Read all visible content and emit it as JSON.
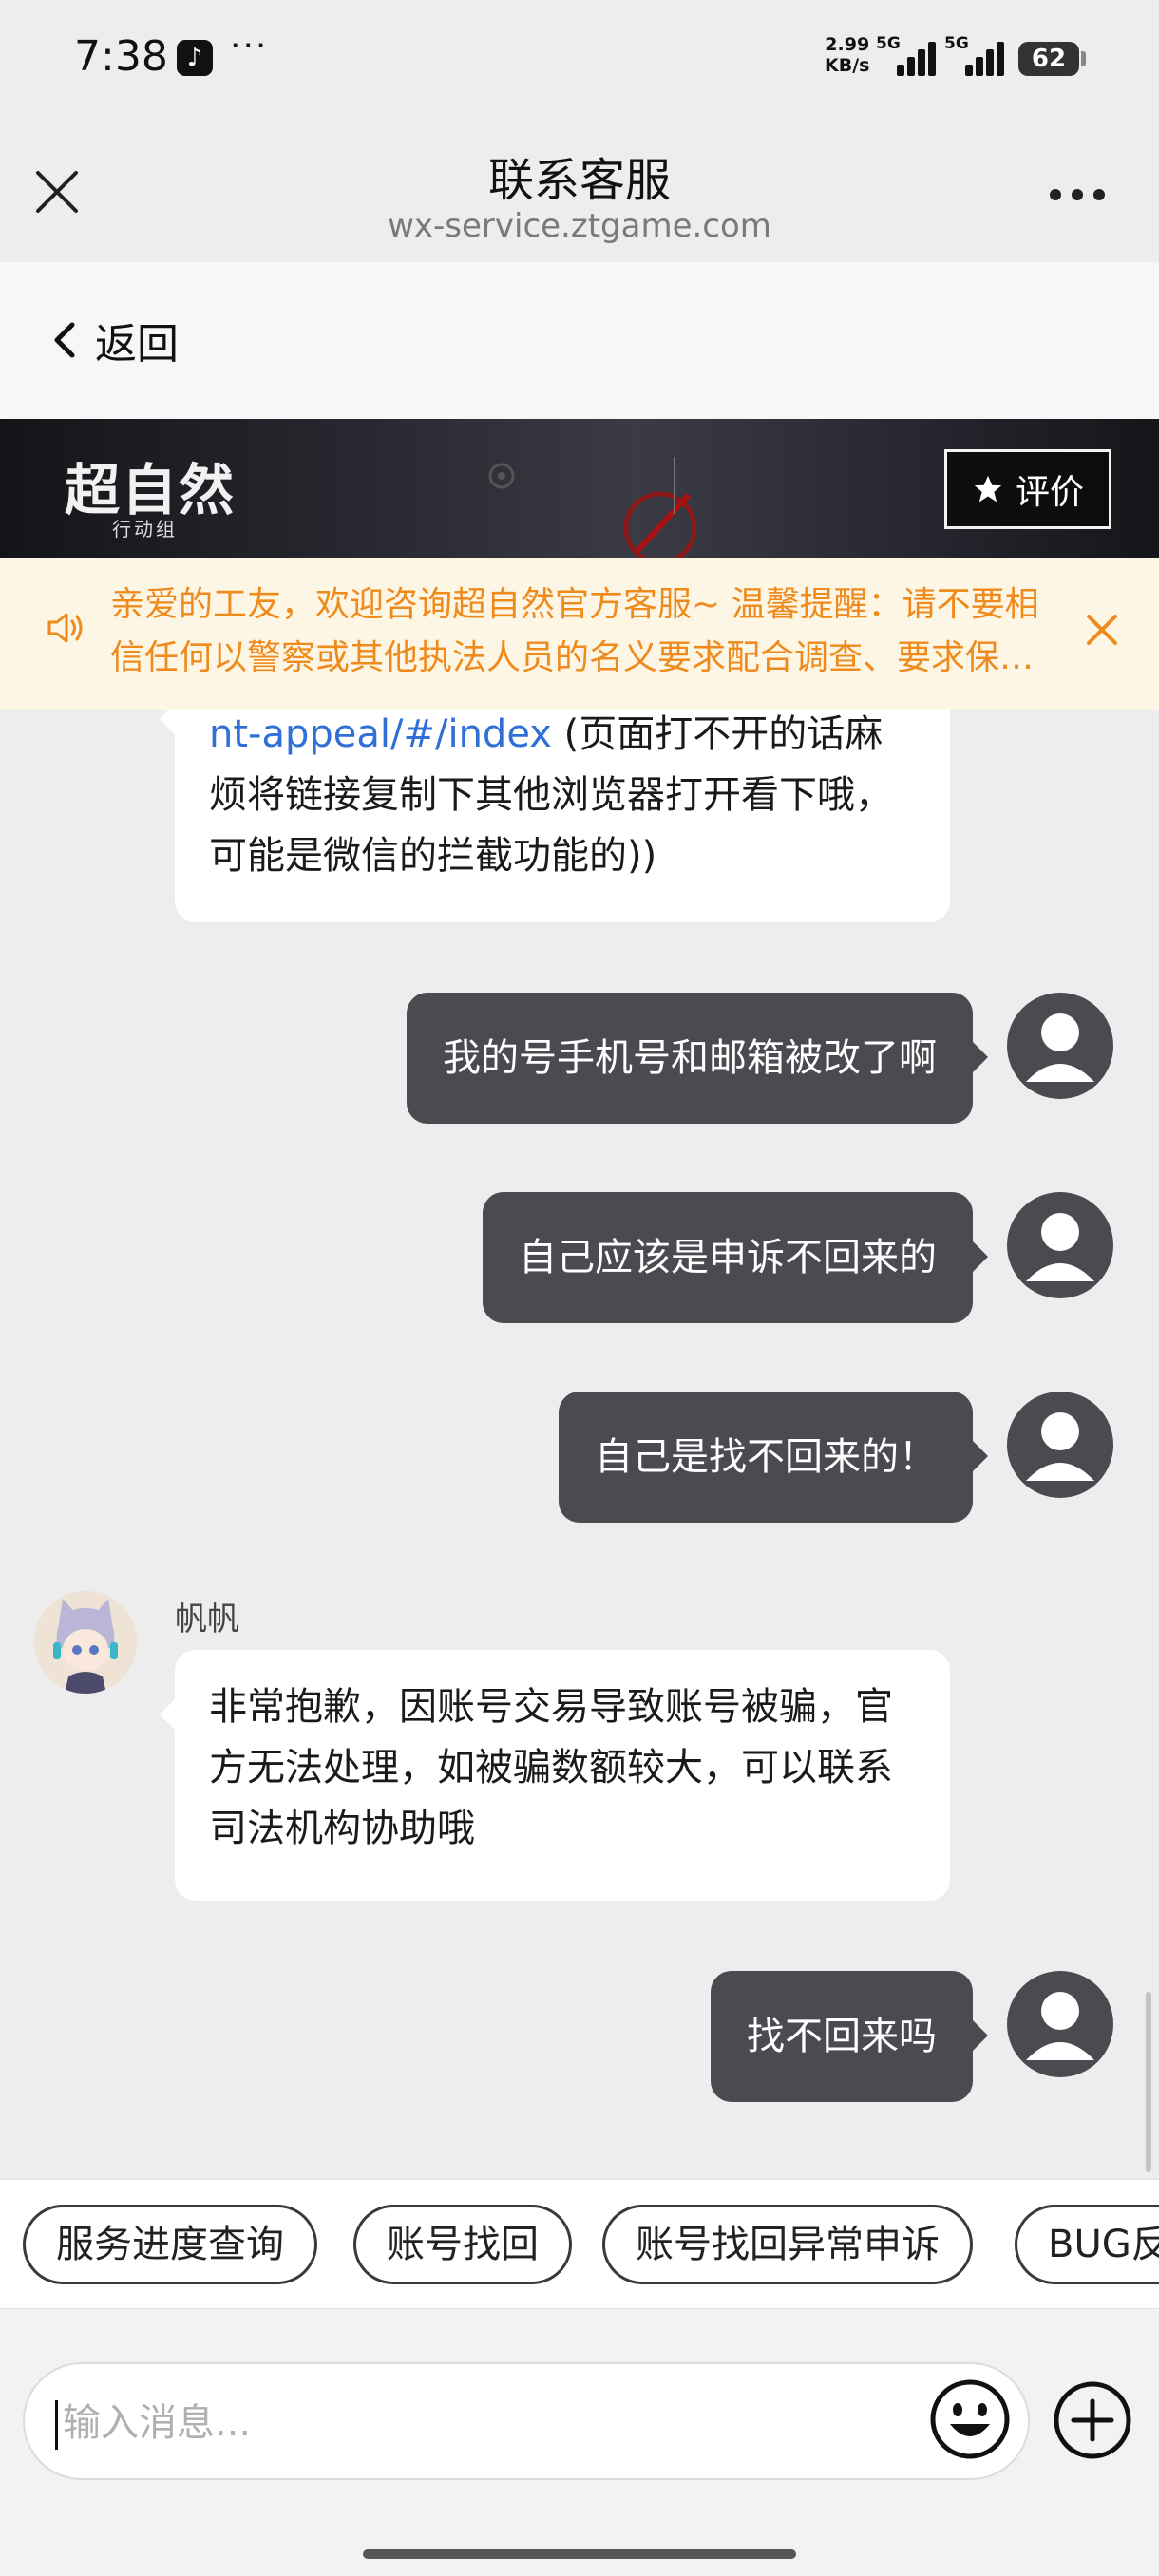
{
  "status_bar": {
    "time": "7:38",
    "more": "···",
    "net_speed_value": "2.99",
    "net_speed_unit": "KB/s",
    "sig1_label": "5G",
    "sig2_label": "5G",
    "battery": "62"
  },
  "nav": {
    "title": "联系客服",
    "subtitle": "wx-service.ztgame.com"
  },
  "back": {
    "label": "返回"
  },
  "banner": {
    "logo": "超自然",
    "logo_sub": "行动组",
    "rate_label": "评价"
  },
  "notice": {
    "text": "亲爱的工友，欢迎咨询超自然官方客服~ 温馨提醒：请不要相信任何以警察或其他执法人员的名义要求配合调查、要求保…"
  },
  "messages": {
    "m1_link": "nt-appeal/#/index",
    "m1_text": " (页面打不开的话麻烦将链接复制下其他浏览器打开看下哦，可能是微信的拦截功能的))",
    "m2": "我的号手机号和邮箱被改了啊",
    "m3": "自己应该是申诉不回来的",
    "m4": "自己是找不回来的！",
    "agent_name": "帆帆",
    "m5": "非常抱歉，因账号交易导致账号被骗，官方无法处理，如被骗数额较大，可以联系司法机构协助哦",
    "m6": "找不回来吗"
  },
  "quick_replies": [
    "服务进度查询",
    "账号找回",
    "账号找回异常申诉",
    "BUG反"
  ],
  "input": {
    "placeholder": "输入消息..."
  },
  "colors": {
    "notice_text": "#ef8a1d",
    "notice_bg": "#fdf6e4",
    "outgoing_bubble": "#4a4b50",
    "link": "#2f6fd6"
  }
}
